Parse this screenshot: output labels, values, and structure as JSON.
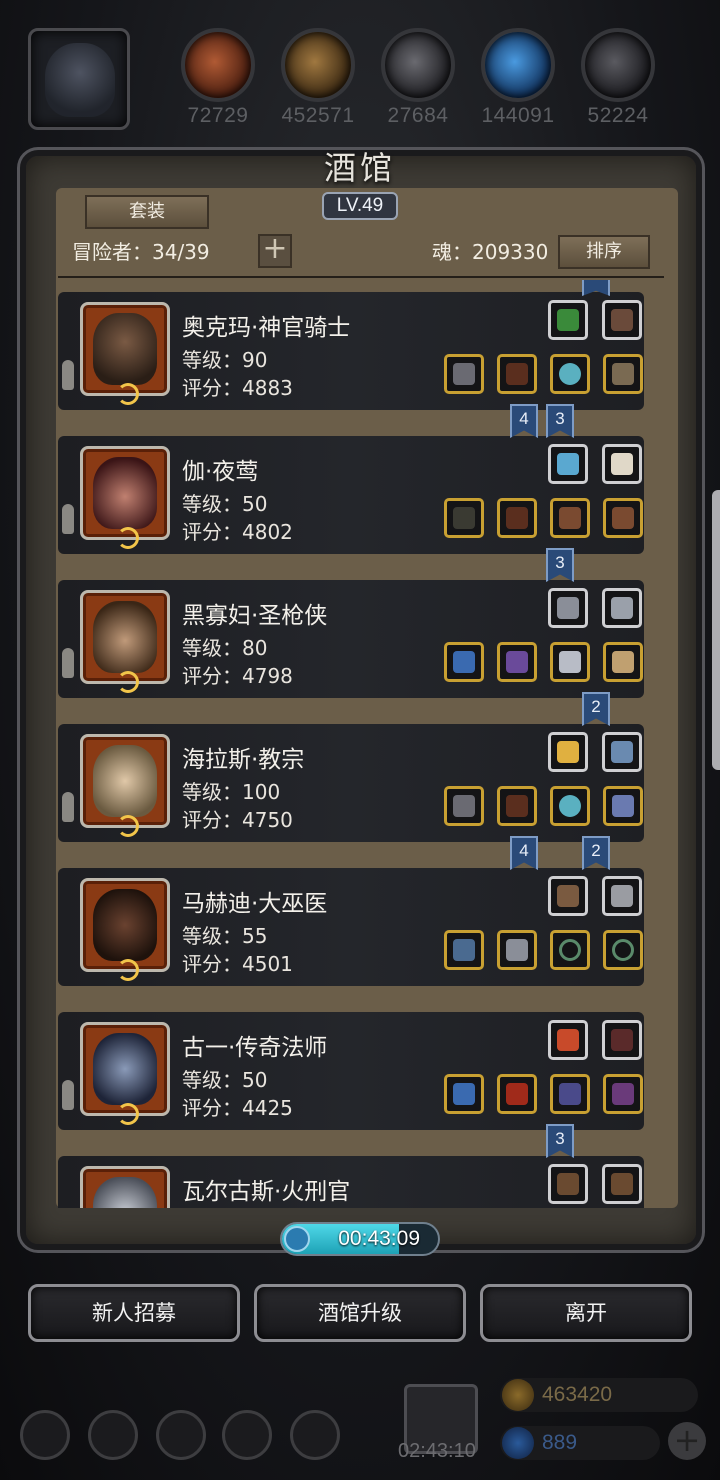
{
  "resources": [
    {
      "name": "meat",
      "value": "72729",
      "color": "#7a3a22"
    },
    {
      "name": "wood",
      "value": "452571",
      "color": "#6a4a26"
    },
    {
      "name": "iron",
      "value": "27684",
      "color": "#3c3c40"
    },
    {
      "name": "crystal",
      "value": "144091",
      "color": "#2a5a9a"
    },
    {
      "name": "stone",
      "value": "52224",
      "color": "#3a3a3e"
    }
  ],
  "panel": {
    "title": "酒馆",
    "level": "LV.49",
    "set_button": "套装",
    "adventurers": "冒险者：34/39",
    "soul": "魂：209330",
    "sort_button": "排序",
    "add_icon": "plus-icon"
  },
  "heroes": [
    {
      "name": "奥克玛·神官骑士",
      "level": "等级：90",
      "score": "评分：4883",
      "portrait": "#4a3a2c"
    },
    {
      "name": "伽·夜莺",
      "level": "等级：50",
      "score": "评分：4802",
      "portrait": "#6a2a2e"
    },
    {
      "name": "黑寡妇·圣枪侠",
      "level": "等级：80",
      "score": "评分：4798",
      "portrait": "#5a4430"
    },
    {
      "name": "海拉斯·教宗",
      "level": "等级：100",
      "score": "评分：4750",
      "portrait": "#8a7a5a"
    },
    {
      "name": "马赫迪·大巫医",
      "level": "等级：55",
      "score": "评分：4501",
      "portrait": "#3a2418"
    },
    {
      "name": "古一·传奇法师",
      "level": "等级：50",
      "score": "评分：4425",
      "portrait": "#2e3a56"
    },
    {
      "name": "瓦尔古斯·火刑官",
      "level": "",
      "score": "",
      "portrait": "#8a8e98"
    }
  ],
  "bookmarks": [
    "4",
    "3",
    "3",
    "2",
    "4",
    "2",
    "3"
  ],
  "timer": {
    "text": "00:43:09",
    "progress": 0.75
  },
  "buttons": {
    "recruit": "新人招募",
    "upgrade": "酒馆升级",
    "leave": "离开"
  },
  "hud": {
    "gift_timer": "02:43:10",
    "gold": "463420",
    "gems": "889"
  }
}
